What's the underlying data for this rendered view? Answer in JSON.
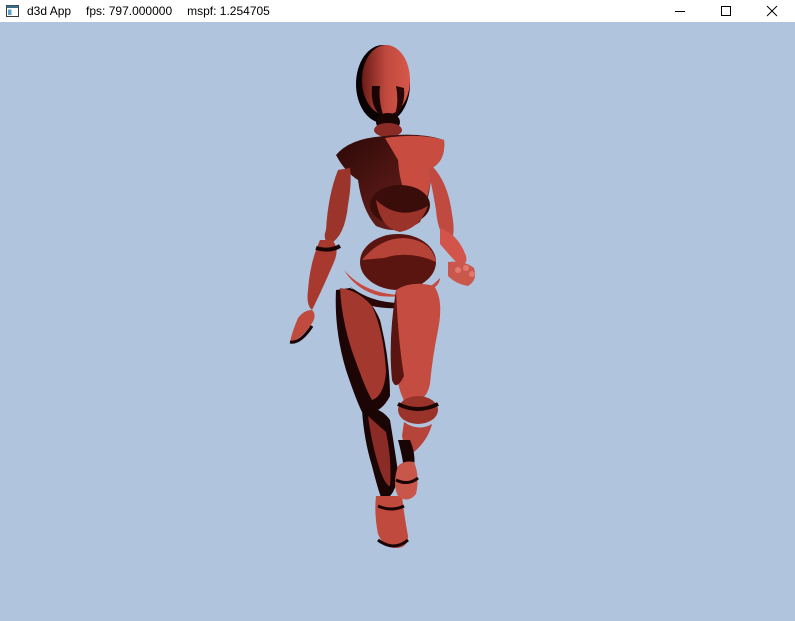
{
  "window": {
    "title": "d3d App",
    "fps": "fps: 797.000000",
    "mspf": "mspf: 1.254705",
    "icon": "app-window-icon"
  },
  "controls": {
    "minimize_icon": "minimize-icon",
    "maximize_icon": "maximize-icon",
    "close_icon": "close-icon"
  },
  "scene": {
    "background_color": "#b0c4de",
    "model": "skinned-character-model",
    "model_color": "#c0493e"
  }
}
